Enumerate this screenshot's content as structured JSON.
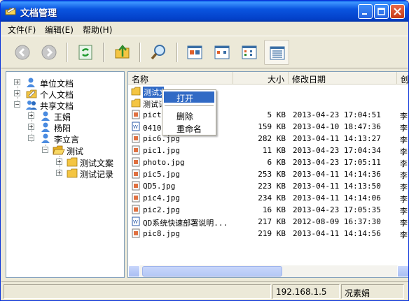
{
  "window": {
    "title": "文档管理"
  },
  "menu": [
    {
      "label": "文件(F)"
    },
    {
      "label": "编辑(E)"
    },
    {
      "label": "帮助(H)"
    }
  ],
  "toolbar": {
    "buttons": [
      "back-icon",
      "forward-icon",
      "refresh-icon",
      "up-folder-icon",
      "search-icon",
      "view-large-icon",
      "view-small-icon",
      "view-list-icon",
      "view-details-icon"
    ]
  },
  "tree": {
    "nodes": [
      {
        "label": "单位文档",
        "icon": "folder-user-icon",
        "expander": "+"
      },
      {
        "label": "个人文档",
        "icon": "folder-personal-icon",
        "expander": "+"
      },
      {
        "label": "共享文档",
        "icon": "folder-shared-icon",
        "expander": "−"
      },
      {
        "label": "王娟",
        "icon": "user-icon",
        "expander": "+"
      },
      {
        "label": "杨阳",
        "icon": "user-icon",
        "expander": "+"
      },
      {
        "label": "李立言",
        "icon": "user-icon",
        "expander": "−"
      },
      {
        "label": "测试",
        "icon": "folder-open-icon",
        "expander": "−"
      },
      {
        "label": "测试文案",
        "icon": "folder-icon",
        "expander": "+"
      },
      {
        "label": "测试记录",
        "icon": "folder-icon",
        "expander": "+"
      }
    ]
  },
  "list": {
    "columns": [
      "名称",
      "大小",
      "修改日期",
      "创"
    ],
    "rows": [
      {
        "name": "测试文",
        "size": "",
        "date": "",
        "extra": "",
        "type": "folder"
      },
      {
        "name": "测试记",
        "size": "",
        "date": "",
        "extra": "",
        "type": "folder"
      },
      {
        "name": "pictu",
        "size": "5 KB",
        "date": "2013-04-23 17:04:51",
        "extra": "李",
        "type": "image"
      },
      {
        "name": "0410报",
        "size": "159 KB",
        "date": "2013-04-10 18:47:36",
        "extra": "李",
        "type": "doc"
      },
      {
        "name": "pic6.jpg",
        "size": "282 KB",
        "date": "2013-04-11 14:13:27",
        "extra": "李",
        "type": "image"
      },
      {
        "name": "pic1.jpg",
        "size": "11 KB",
        "date": "2013-04-23 17:04:34",
        "extra": "李",
        "type": "image"
      },
      {
        "name": "photo.jpg",
        "size": "6 KB",
        "date": "2013-04-23 17:05:11",
        "extra": "李",
        "type": "image"
      },
      {
        "name": "pic5.jpg",
        "size": "253 KB",
        "date": "2013-04-11 14:14:36",
        "extra": "李",
        "type": "image"
      },
      {
        "name": "QD5.jpg",
        "size": "223 KB",
        "date": "2013-04-11 14:13:50",
        "extra": "李",
        "type": "image"
      },
      {
        "name": "pic4.jpg",
        "size": "234 KB",
        "date": "2013-04-11 14:14:06",
        "extra": "李",
        "type": "image"
      },
      {
        "name": "pic2.jpg",
        "size": "16 KB",
        "date": "2013-04-23 17:05:35",
        "extra": "李",
        "type": "image"
      },
      {
        "name": "QD系统快速部署说明...",
        "size": "217 KB",
        "date": "2012-08-09 16:37:30",
        "extra": "李",
        "type": "doc"
      },
      {
        "name": "pic8.jpg",
        "size": "219 KB",
        "date": "2013-04-11 14:14:56",
        "extra": "李",
        "type": "image"
      }
    ]
  },
  "context_menu": {
    "items": [
      {
        "label": "打开",
        "selected": true
      },
      {
        "label": "删除",
        "selected": false
      },
      {
        "label": "重命名",
        "selected": false
      }
    ]
  },
  "status": {
    "left": "",
    "ip": "192.168.1.5",
    "user": "况素娟"
  }
}
